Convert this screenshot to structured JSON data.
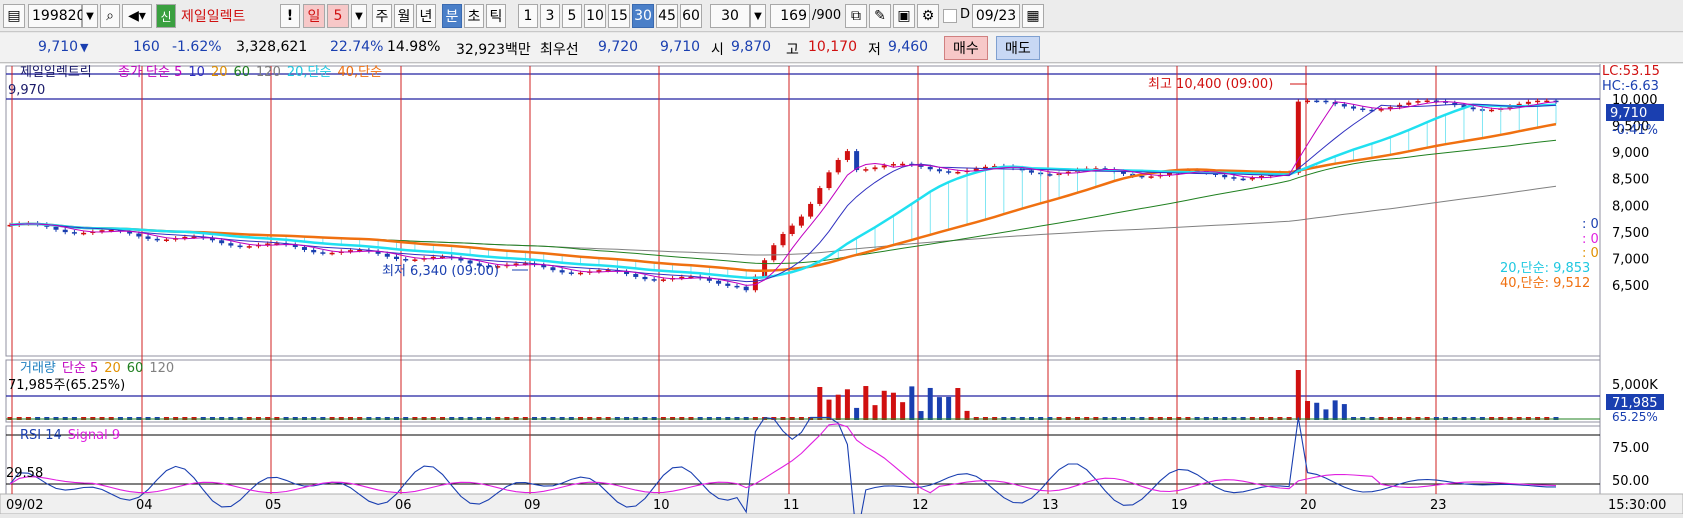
{
  "toolbar": {
    "code": "199820",
    "name": "제일일렉트",
    "sin_badge": "신",
    "period_label": "일",
    "period_num": "5",
    "buttons": [
      "주",
      "월",
      "년",
      "분",
      "초",
      "틱",
      "1",
      "3",
      "5",
      "10",
      "15",
      "30",
      "45",
      "60"
    ],
    "selected_buttons": [
      "분",
      "30"
    ],
    "interval": "30",
    "count": "169",
    "count_total": "/900",
    "d_label": "D",
    "date": "09/23"
  },
  "info": {
    "price": "9,710",
    "change": "160",
    "change_pct": "-1.62%",
    "volume": "3,328,621",
    "ratio1": "22.74%",
    "ratio2": "14.98%",
    "amount": "32,923백만",
    "best_bid_label": "최우선",
    "best_ask": "9,720",
    "best_bid": "9,710",
    "open_label": "시",
    "open": "9,870",
    "high_label": "고",
    "high": "10,170",
    "low_label": "저",
    "low": "9,460",
    "buy": "매수",
    "sell": "매도"
  },
  "price_panel": {
    "stock_name": "제일일렉트릭",
    "legend": [
      {
        "text": "종가 단순 5",
        "color": "#c000c0"
      },
      {
        "text": "10",
        "color": "#3030c0"
      },
      {
        "text": "20",
        "color": "#e09000"
      },
      {
        "text": "60",
        "color": "#208020"
      },
      {
        "text": "120",
        "color": "#808080"
      },
      {
        "text": "20,단순",
        "color": "#20c8e0"
      },
      {
        "text": "40,단순",
        "color": "#f07010"
      }
    ],
    "left_value": "9,970",
    "lc": "LC:53.15",
    "hc": "HC:-6.63",
    "current_price": "9,710",
    "current_pct": "-0.41%",
    "high_annot": "최고 10,400 (09:00)",
    "low_annot": "최저 6,340 (09:00)",
    "zeros": [
      ": 0",
      ": 0",
      ": 0"
    ],
    "ma20_label": "20,단순: 9,853",
    "ma40_label": "40,단순: 9,512",
    "y_ticks": [
      "10,000",
      "9,500",
      "9,000",
      "8,500",
      "8,000",
      "7,500",
      "7,000",
      "6,500"
    ]
  },
  "volume_panel": {
    "legend": [
      {
        "text": "거래량",
        "color": "#2080c0"
      },
      {
        "text": "단순 5",
        "color": "#c000c0"
      },
      {
        "text": "20",
        "color": "#e09000"
      },
      {
        "text": "60",
        "color": "#208020"
      },
      {
        "text": "120",
        "color": "#808080"
      }
    ],
    "left_value": "71,985주(65.25%)",
    "y_tick": "5,000K",
    "current": "71,985",
    "current_pct": "65.25%"
  },
  "rsi_panel": {
    "legend": [
      {
        "text": "RSI 14",
        "color": "#1a3fb0"
      },
      {
        "text": "Signal 9",
        "color": "#e020e0"
      }
    ],
    "left_value": "29.58",
    "y_ticks": [
      "75.00",
      "50.00"
    ]
  },
  "x_axis": {
    "labels": [
      "09/02",
      "04",
      "05",
      "06",
      "09",
      "10",
      "11",
      "12",
      "13",
      "19",
      "20",
      "23"
    ],
    "time": "15:30:00"
  }
}
